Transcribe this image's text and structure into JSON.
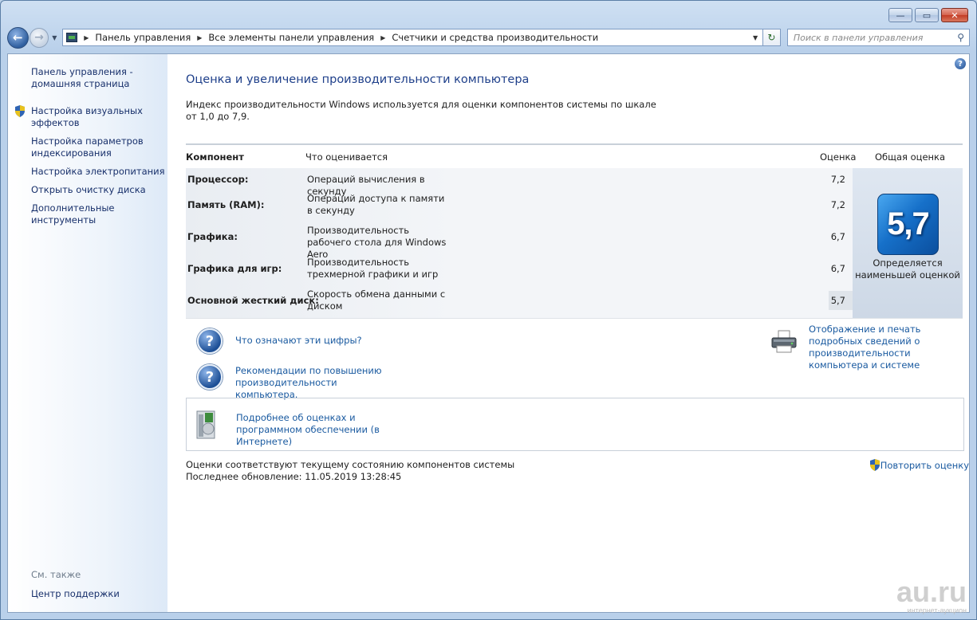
{
  "window": {
    "caption_buttons": {
      "minimize": "—",
      "maximize": "▭",
      "close": "✕"
    }
  },
  "nav": {
    "breadcrumbs": [
      "Панель управления",
      "Все элементы панели управления",
      "Счетчики и средства производительности"
    ],
    "search_placeholder": "Поиск в панели управления",
    "icons": {
      "back": "back-arrow-icon",
      "forward": "forward-arrow-icon",
      "search": "search-icon",
      "refresh": "refresh-icon"
    }
  },
  "sidebar": {
    "home_link": "Панель управления - домашняя страница",
    "items": [
      {
        "label": "Настройка визуальных эффектов",
        "icon": "shield-icon"
      },
      {
        "label": "Настройка параметров индексирования"
      },
      {
        "label": "Настройка электропитания"
      },
      {
        "label": "Открыть очистку диска"
      },
      {
        "label": "Дополнительные инструменты"
      }
    ],
    "see_also_heading": "См. также",
    "see_also_links": [
      "Центр поддержки"
    ]
  },
  "main": {
    "title": "Оценка и увеличение производительности компьютера",
    "intro": "Индекс производительности Windows используется для оценки компонентов системы по шкале от 1,0 до 7,9.",
    "table": {
      "headers": {
        "component": "Компонент",
        "what": "Что оценивается",
        "score": "Оценка",
        "overall": "Общая оценка"
      },
      "rows": [
        {
          "component": "Процессор:",
          "what": "Операций вычисления в секунду",
          "score": "7,2"
        },
        {
          "component": "Память (RAM):",
          "what": "Операций доступа к памяти в секунду",
          "score": "7,2"
        },
        {
          "component": "Графика:",
          "what": "Производительность рабочего стола для Windows Aero",
          "score": "6,7"
        },
        {
          "component": "Графика для игр:",
          "what": "Производительность трехмерной графики и игр",
          "score": "6,7"
        },
        {
          "component": "Основной жесткий диск:",
          "what": "Скорость обмена данными с диском",
          "score": "5,7"
        }
      ],
      "overall_score": "5,7",
      "overall_caption": "Определяется наименьшей оценкой"
    },
    "links": {
      "what_numbers_mean": "Что означают эти цифры?",
      "recommendations": "Рекомендации по повышению производительности компьютера.",
      "print_details": "Отображение и печать подробных сведений о производительности компьютера и системе",
      "more_online": "Подробнее об оценках и программном обеспечении (в Интернете)"
    },
    "status_line": "Оценки соответствуют текущему состоянию компонентов системы",
    "last_update": "Последнее обновление: 11.05.2019 13:28:45",
    "rerun_link": "Повторить оценку",
    "help_icon": "help-icon"
  },
  "watermark": {
    "big": "au.ru",
    "small": "интернет-аукцион"
  },
  "colors": {
    "link": "#1a5aa0",
    "title": "#1e3f8a",
    "badge": "#1670c9"
  }
}
